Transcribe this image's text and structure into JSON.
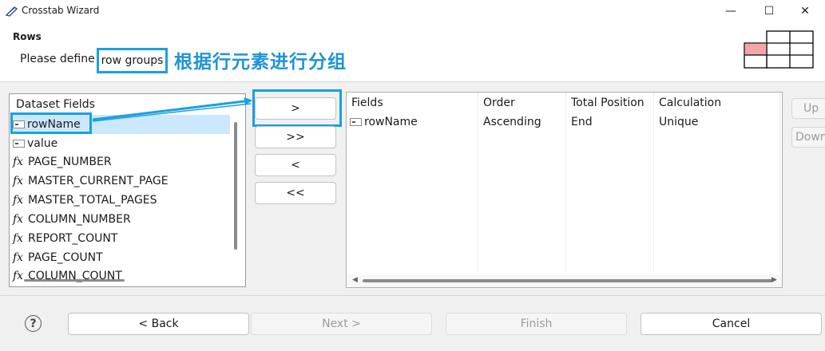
{
  "window": {
    "title": "Crosstab Wizard",
    "icon": "eclipse-icon",
    "controls": {
      "minimize": "—",
      "maximize": "☐",
      "close": "✕"
    }
  },
  "header": {
    "title": "Rows",
    "description_prefix": "Please define",
    "description_highlight": "row groups",
    "annotation": "根据行元素进行分组",
    "annotation_color": "#1f94d6"
  },
  "dataset_fields": {
    "header": "Dataset Fields",
    "items": [
      {
        "label": "rowName",
        "icon": "column-icon",
        "selected": true
      },
      {
        "label": "value",
        "icon": "column-icon"
      },
      {
        "label": "PAGE_NUMBER",
        "icon": "fx-icon"
      },
      {
        "label": "MASTER_CURRENT_PAGE",
        "icon": "fx-icon"
      },
      {
        "label": "MASTER_TOTAL_PAGES",
        "icon": "fx-icon"
      },
      {
        "label": "COLUMN_NUMBER",
        "icon": "fx-icon"
      },
      {
        "label": "REPORT_COUNT",
        "icon": "fx-icon"
      },
      {
        "label": "PAGE_COUNT",
        "icon": "fx-icon"
      },
      {
        "label": "COLUMN_COUNT",
        "icon": "fx-icon"
      }
    ]
  },
  "move_buttons": {
    "add": ">",
    "add_all": ">>",
    "remove": "<",
    "remove_all": "<<"
  },
  "row_groups": {
    "columns": [
      "Fields",
      "Order",
      "Total Position",
      "Calculation"
    ],
    "rows": [
      {
        "field": "rowName",
        "order": "Ascending",
        "total_position": "End",
        "calculation": "Unique"
      }
    ]
  },
  "side_buttons": {
    "up": "Up",
    "down": "Down"
  },
  "footer": {
    "help": "?",
    "back": "< Back",
    "next": "Next >",
    "finish": "Finish",
    "cancel": "Cancel"
  },
  "colors": {
    "accent": "#1aa0e0",
    "selection": "#cce8ff",
    "grid_highlight": "#f4a6a6"
  },
  "icon_glyphs": {
    "fx": "fx"
  }
}
